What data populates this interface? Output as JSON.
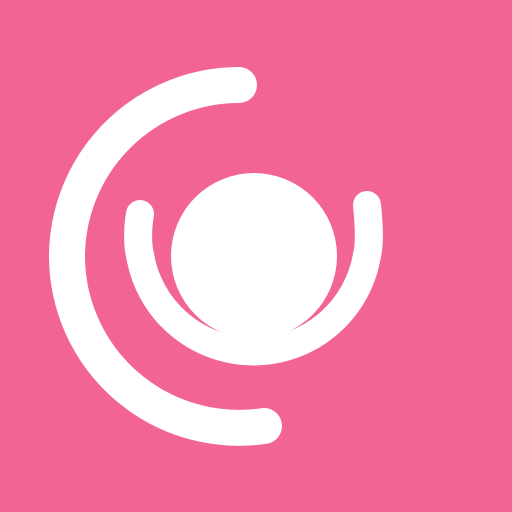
{
  "colors": {
    "background": "#F26494",
    "foreground": "#FFFFFF"
  },
  "logo": {
    "icon": "concentric-arcs-dot-icon"
  }
}
